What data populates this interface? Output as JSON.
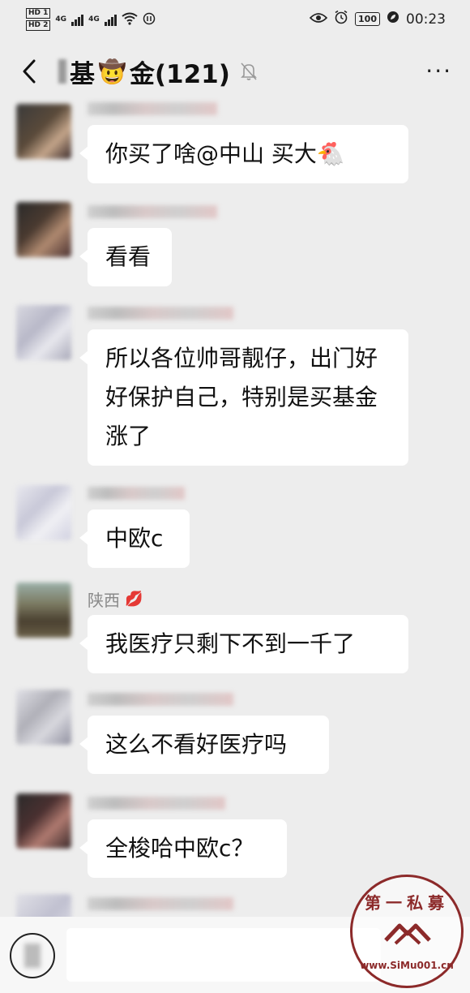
{
  "status_bar": {
    "hd1": "HD 1",
    "hd2": "HD 2",
    "net1": "4G",
    "net2": "4G",
    "battery": "100",
    "time": "00:23",
    "icons": [
      "eye-icon",
      "alarm-icon",
      "battery-icon",
      "leaf-icon",
      "wifi-icon",
      "nfc-icon"
    ]
  },
  "header": {
    "title_prefix": "基",
    "title_emoji": "🤠",
    "title_suffix": "金(121)",
    "more_label": "···"
  },
  "messages": [
    {
      "sender": "",
      "text": "你买了啥@中山  买大🐔"
    },
    {
      "sender": "",
      "text": "看看"
    },
    {
      "sender": "",
      "text": "所以各位帅哥靓仔，出门好好保护自己，特别是买基金涨了"
    },
    {
      "sender": "",
      "text": "中欧c"
    },
    {
      "sender": "陕西",
      "sender_emoji": "💋",
      "text": "我医疗只剩下不到一千了"
    },
    {
      "sender": "",
      "text": "这么不看好医疗吗"
    },
    {
      "sender": "",
      "text": "全梭哈中欧c？"
    }
  ],
  "watermark": {
    "top": "第一私募",
    "bottom": "www.SiMu001.cn"
  },
  "colors": {
    "background": "#ededed",
    "bubble": "#ffffff",
    "watermark": "#8c2a2a"
  }
}
